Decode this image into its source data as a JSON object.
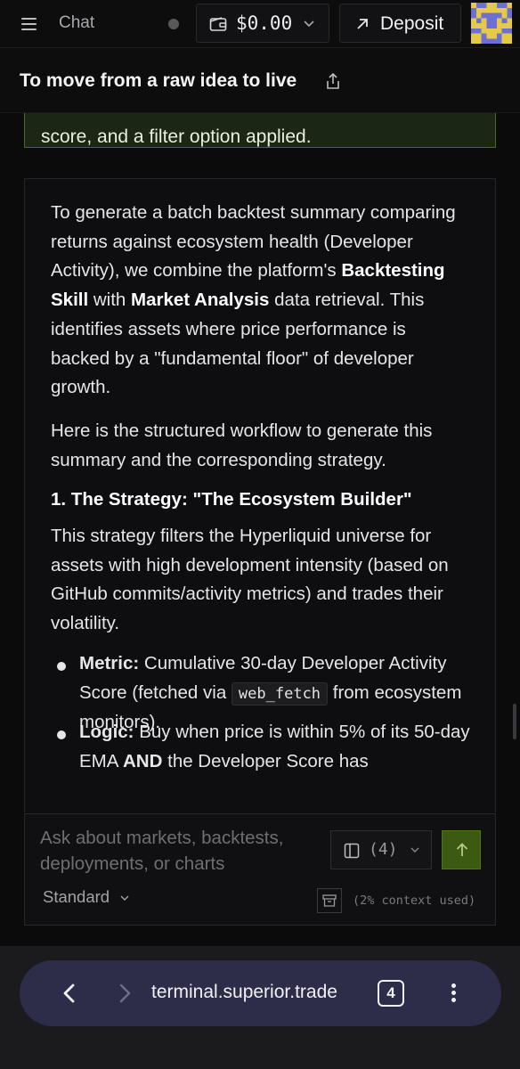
{
  "header": {
    "menu_icon": "hamburger-menu-icon",
    "title": "Chat",
    "wallet": {
      "icon": "wallet-icon",
      "amount": "$0.00"
    },
    "deposit": {
      "icon": "arrow-up-right-icon",
      "label": "Deposit"
    },
    "avatar_icon": "pixel-avatar-icon"
  },
  "thread": {
    "title": "To move from a raw idea to live",
    "share_icon": "share-icon"
  },
  "user_message": {
    "visible_text": "score, and a filter option applied."
  },
  "assistant_message": {
    "p1": {
      "t1": "To generate a batch backtest summary comparing returns against ecosystem health (Developer Activity), we combine the platform's ",
      "b1": "Backtesting Skill",
      "t2": " with ",
      "b2": "Market Analysis",
      "t3": " data retrieval. This identifies assets where price performance is backed by a \"fundamental floor\" of developer growth."
    },
    "p2": "Here is the structured workflow to generate this summary and the corresponding strategy.",
    "h3": "1. The Strategy: \"The Ecosystem Builder\"",
    "p3": "This strategy filters the Hyperliquid universe for assets with high development intensity (based on GitHub commits/activity metrics) and trades their volatility.",
    "bullets": [
      {
        "label": "Metric:",
        "t1": " Cumulative 30-day Developer Activity Score (fetched via ",
        "code": "web_fetch",
        "t2": " from ecosystem monitors)."
      },
      {
        "label": "Logic:",
        "t1": " Buy when price is within 5% of its 50-day EMA ",
        "b": "AND",
        "t2": " the Developer Score has"
      }
    ]
  },
  "composer": {
    "placeholder": "Ask about markets, backtests, deployments, or charts",
    "attach_icon": "panel-icon",
    "attach_count": "(4)",
    "send_icon": "arrow-up-icon",
    "mode": "Standard",
    "archive_icon": "archive-icon",
    "context_used": "(2% context used)"
  },
  "browser": {
    "url": "terminal.superior.trade",
    "tabs_count": "4",
    "back_icon": "chevron-left-icon",
    "forward_icon": "chevron-right-icon",
    "more_icon": "more-vertical-icon"
  },
  "colors": {
    "background": "#0b0b0c",
    "user_bubble_bg": "#1c2614",
    "user_bubble_border": "#4c6a22",
    "send_button": "#3d5a12",
    "browser_pill": "#2d2d4a"
  }
}
